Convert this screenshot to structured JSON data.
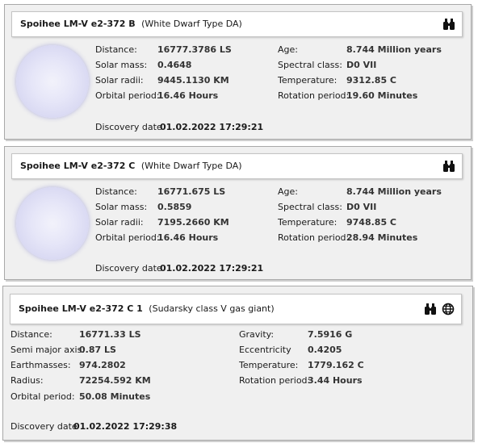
{
  "bodies": [
    {
      "name": "Spoihee LM-V e2-372 B",
      "type": "(White Dwarf Type DA)",
      "icons": [
        "binoculars-icon"
      ],
      "left": [
        {
          "label": "Distance:",
          "value": "16777.3786 LS"
        },
        {
          "label": "Solar mass:",
          "value": "0.4648"
        },
        {
          "label": "Solar radii:",
          "value": "9445.1130 KM"
        },
        {
          "label": "Orbital period:",
          "value": "16.46 Hours"
        }
      ],
      "right": [
        {
          "label": "Age:",
          "value": "8.744 Million years"
        },
        {
          "label": "Spectral class:",
          "value": "D0 VII"
        },
        {
          "label": "Temperature:",
          "value": "9312.85 C"
        },
        {
          "label": "Rotation period:",
          "value": "19.60 Minutes"
        }
      ],
      "discovery_label": "Discovery date",
      "discovery_value": "01.02.2022 17:29:21"
    },
    {
      "name": "Spoihee LM-V e2-372 C",
      "type": "(White Dwarf Type DA)",
      "icons": [
        "binoculars-icon"
      ],
      "left": [
        {
          "label": "Distance:",
          "value": "16771.675 LS"
        },
        {
          "label": "Solar mass:",
          "value": "0.5859"
        },
        {
          "label": "Solar radii:",
          "value": "7195.2660 KM"
        },
        {
          "label": "Orbital period:",
          "value": "16.46 Hours"
        }
      ],
      "right": [
        {
          "label": "Age:",
          "value": "8.744 Million years"
        },
        {
          "label": "Spectral class:",
          "value": "D0 VII"
        },
        {
          "label": "Temperature:",
          "value": "9748.85 C"
        },
        {
          "label": "Rotation period:",
          "value": "28.94 Minutes"
        }
      ],
      "discovery_label": "Discovery date",
      "discovery_value": "01.02.2022 17:29:21"
    },
    {
      "name": "Spoihee LM-V e2-372 C 1",
      "type": "(Sudarsky class V gas giant)",
      "icons": [
        "binoculars-icon",
        "globe-icon"
      ],
      "left": [
        {
          "label": "Distance:",
          "value": "16771.33 LS"
        },
        {
          "label": "Semi major axis:",
          "value": "0.87 LS"
        },
        {
          "label": "Earthmasses:",
          "value": "974.2802"
        },
        {
          "label": "Radius:",
          "value": "72254.592 KM"
        },
        {
          "label": "Orbital period:",
          "value": "50.08 Minutes"
        }
      ],
      "right": [
        {
          "label": "Gravity:",
          "value": "7.5916 G"
        },
        {
          "label": "Eccentricity",
          "value": "0.4205"
        },
        {
          "label": "Temperature:",
          "value": "1779.162 C"
        },
        {
          "label": "Rotation period:",
          "value": "3.44 Hours"
        }
      ],
      "discovery_label": "Discovery date",
      "discovery_value": "01.02.2022 17:29:38"
    }
  ]
}
